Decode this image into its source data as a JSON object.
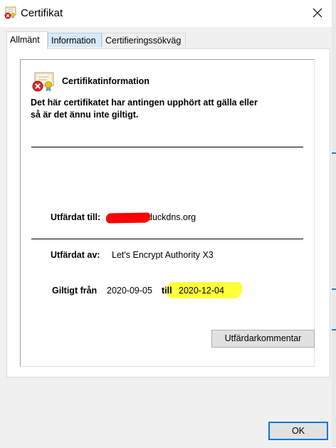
{
  "window": {
    "title": "Certifikat"
  },
  "tabs": [
    {
      "label": "Allmänt",
      "active": true
    },
    {
      "label": "Information",
      "active": false
    },
    {
      "label": "Certifieringssökväg",
      "active": false
    }
  ],
  "general": {
    "heading": "Certifikatinformation",
    "warning_line1": "Det här certifikatet har antingen upphört att gälla eller",
    "warning_line2": "så är det ännu inte giltigt.",
    "issued_to_label": "Utfärdat till:",
    "issued_to_value": "duckdns.org",
    "issued_by_label": "Utfärdat av:",
    "issued_by_value": "Let's Encrypt Authority X3",
    "valid_from_label": "Giltigt från",
    "valid_from_value": "2020-09-05",
    "valid_to_label": "till",
    "valid_to_value": "2020-12-04"
  },
  "buttons": {
    "issuer_statement": "Utfärdarkommentar",
    "ok": "OK"
  },
  "colors": {
    "accent": "#0078d7",
    "redaction": "#ff0000",
    "highlight": "#ffff3a"
  },
  "icons": {
    "title": "certificate-error-icon",
    "close": "close-icon",
    "info": "certificate-error-icon"
  }
}
